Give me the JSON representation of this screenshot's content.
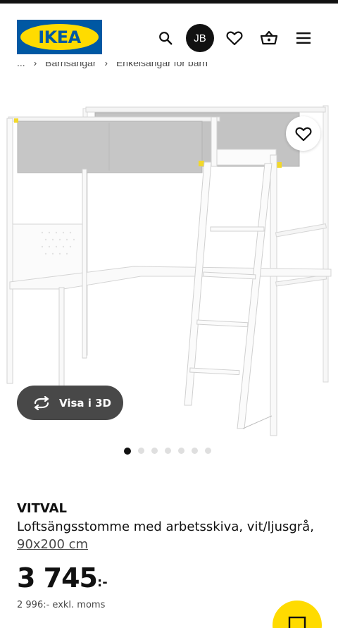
{
  "header": {
    "logo_text": "IKEA",
    "avatar_initials": "JB",
    "icons": [
      "search-icon",
      "heart-icon",
      "basket-icon",
      "menu-icon"
    ]
  },
  "breadcrumb": {
    "items": [
      "...",
      "Barnsängar",
      "Enkelsängar för barn"
    ],
    "separator": "›"
  },
  "gallery": {
    "view3d_label": "Visa i 3D",
    "slide_count": 7,
    "active_slide": 1
  },
  "product": {
    "name": "VITVAL",
    "description": "Loftsängsstomme med arbetsskiva, vit/ljusgrå,",
    "size": "90x200 cm",
    "price": "3 745",
    "price_suffix": ":-",
    "price_excl_vat": "2 996:- exkl. moms"
  },
  "colors": {
    "brand_blue": "#0058a3",
    "brand_yellow": "#ffdb00",
    "pill_bg": "#484848"
  }
}
